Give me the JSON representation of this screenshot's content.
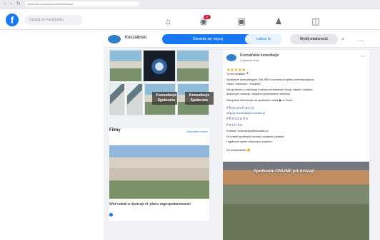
{
  "browser": {
    "address": "facebook.com/spolecznekonsultacje"
  },
  "topbar": {
    "search_placeholder": "Szukaj na Facebooku",
    "notification_count": "2"
  },
  "page": {
    "name": "Koszalinski",
    "follow_label": "Dowiedz się więcej",
    "like_label": "Lubisz to",
    "message_label": "Wyślij wiadomość"
  },
  "photos": {
    "labels": [
      "Konsultacje Społeczne",
      "Konsultacje Społeczne"
    ]
  },
  "films": {
    "title": "Filmy",
    "see_all": "Wszystkie wideo",
    "caption": "Weź udział w dyskusji nt. planu zagospodarowania!"
  },
  "post": {
    "author": "Koszalińskie konsultacje",
    "time": "2 godziny temu",
    "lines": [
      "Ty też działasz 📍",
      "Spotkanie konsultacyjne ONLINE w sprawie projektu przedsięwzięcia",
      "Gdzie: Dzielnica - Koszalin",
      "Na spotkaniu z dyskusją możesz przedstawić swoje zdanie i pytania",
      "dotyczące rozwoju i wspólnej przestrzeni dzielnicy.",
      "Wszystkie informacje na spotkaniu online ▶ w Zoom",
      "Więcej: konsultacje.koszalin.pl",
      "Kontakt: konsultacje@koszalin.pl",
      "W czasie spotkania możesz zadawać pytania",
      "i zgłaszać opinie dotyczące projektu.",
      "Do zobaczenia! 🙂"
    ],
    "hashtags": [
      "#konsultacje",
      "#Koszalin",
      "#online"
    ],
    "promo_title": "Spotkanie ONLINE już dzisiaj!"
  }
}
